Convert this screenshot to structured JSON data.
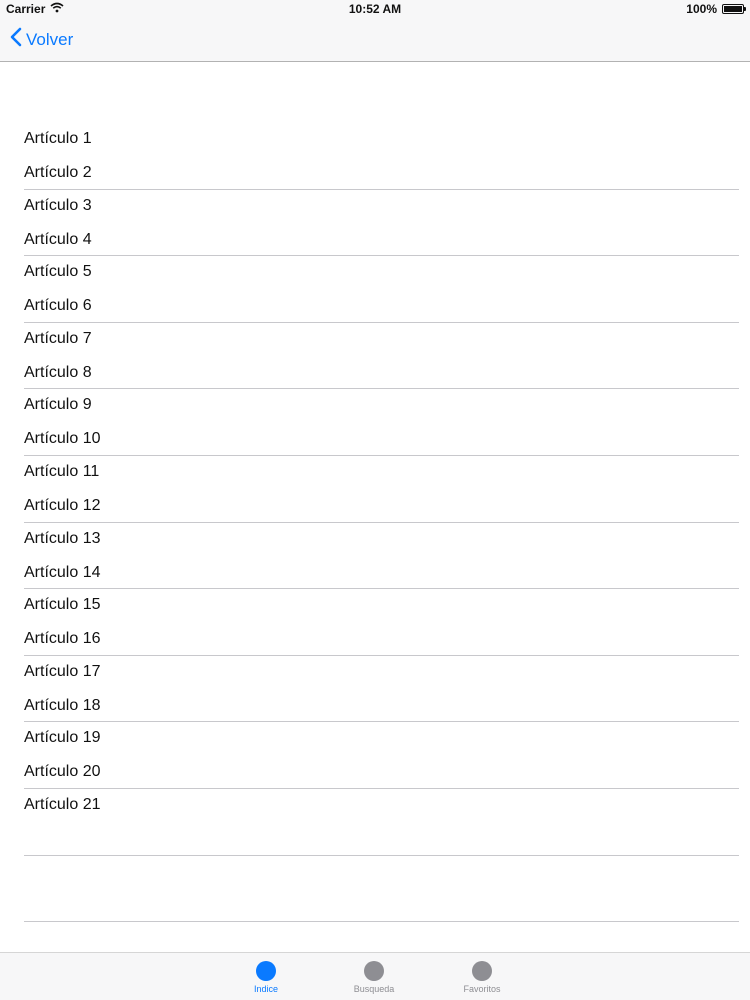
{
  "status_bar": {
    "carrier": "Carrier",
    "time": "10:52 AM",
    "battery": "100%",
    "battery_level": 1.0
  },
  "nav": {
    "back_label": "Volver"
  },
  "list": {
    "rows": [
      {
        "title": "Artículo 1",
        "subtitle": "Artículo 2"
      },
      {
        "title": "Artículo 3",
        "subtitle": "Artículo 4"
      },
      {
        "title": "Artículo 5",
        "subtitle": "Artículo 6"
      },
      {
        "title": "Artículo 7",
        "subtitle": "Artículo 8"
      },
      {
        "title": "Artículo 9",
        "subtitle": "Artículo 10"
      },
      {
        "title": "Artículo 11",
        "subtitle": "Artículo 12"
      },
      {
        "title": "Artículo 13",
        "subtitle": "Artículo 14"
      },
      {
        "title": "Artículo 15",
        "subtitle": "Artículo 16"
      },
      {
        "title": "Artículo 17",
        "subtitle": "Artículo 18"
      },
      {
        "title": "Artículo 19",
        "subtitle": "Artículo 20"
      },
      {
        "title": "Artículo 21",
        "subtitle": ""
      },
      {
        "title": "",
        "subtitle": ""
      }
    ]
  },
  "tab_bar": {
    "tabs": [
      {
        "label": "Indice",
        "active": true
      },
      {
        "label": "Busqueda",
        "active": false
      },
      {
        "label": "Favoritos",
        "active": false
      }
    ]
  },
  "colors": {
    "accent": "#0a7aff",
    "inactive": "#8e8e93",
    "separator": "#c8c8cc",
    "bar_background": "#f7f7f8"
  }
}
